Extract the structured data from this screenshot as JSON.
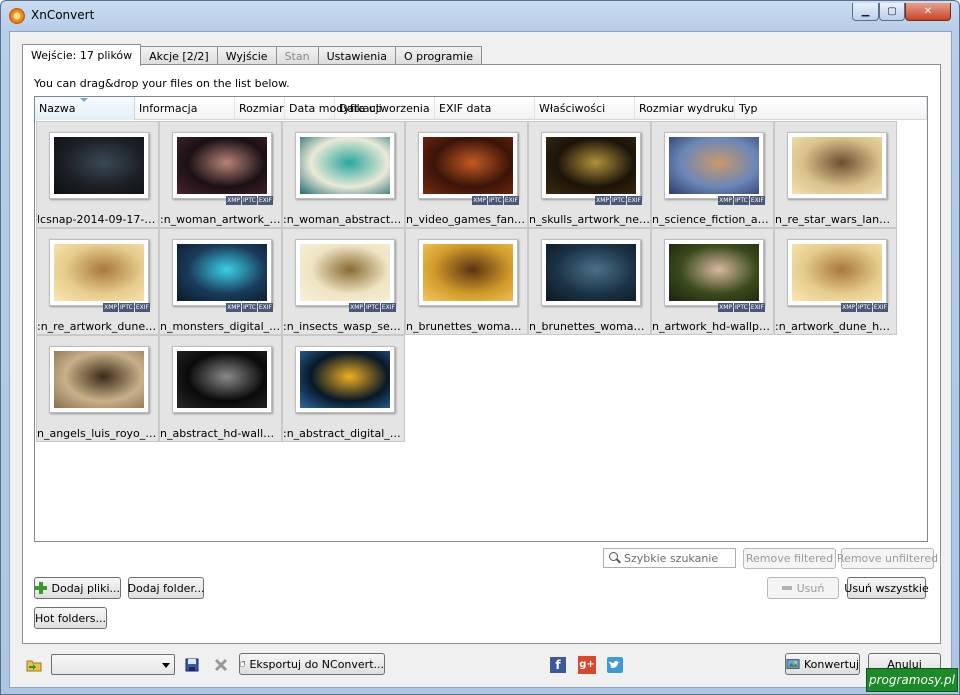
{
  "window": {
    "title": "XnConvert",
    "min_glyph": "▁",
    "max_glyph": "▢",
    "close_glyph": "✕"
  },
  "tabs": [
    {
      "label": "Wejście: 17 plików",
      "state": "active"
    },
    {
      "label": "Akcje [2/2]",
      "state": "normal"
    },
    {
      "label": "Wyjście",
      "state": "normal"
    },
    {
      "label": "Stan",
      "state": "disabled"
    },
    {
      "label": "Ustawienia",
      "state": "normal"
    },
    {
      "label": "O programie",
      "state": "normal"
    }
  ],
  "input": {
    "hint": "You can drag&drop your files on the list below.",
    "columns": [
      "Nazwa",
      "Informacja",
      "Rozmiar",
      "Data modyfikacji",
      "Data utworzenia",
      "EXIF data",
      "Właściwości",
      "Rozmiar wydruku",
      "Typ"
    ],
    "meta_badges": [
      "XMP",
      "IPTC",
      "EXIF"
    ],
    "files": [
      {
        "name": "lcsnap-2014-09-17-13...",
        "badges": false,
        "palette": [
          "#1c2026",
          "#3a4a55",
          "#0d0f12"
        ]
      },
      {
        "name": ":n_woman_artwork_hd...",
        "badges": true,
        "palette": [
          "#1a1014",
          "#b88478",
          "#4a2430"
        ]
      },
      {
        "name": ":n_woman_abstract_d...",
        "badges": false,
        "palette": [
          "#e9ead6",
          "#2aa6a0",
          "#1f6b74"
        ]
      },
      {
        "name": "n_video_games_fanta...",
        "badges": true,
        "palette": [
          "#3a1408",
          "#c45a22",
          "#7a2a12"
        ]
      },
      {
        "name": "n_skulls_artwork_necr...",
        "badges": true,
        "palette": [
          "#1b1408",
          "#b3903c",
          "#3d2a10"
        ]
      },
      {
        "name": "n_science_fiction_art...",
        "badges": true,
        "palette": [
          "#6b86b8",
          "#c89a6a",
          "#2c3d6b"
        ]
      },
      {
        "name": "n_re_star_wars_lands...",
        "badges": false,
        "palette": [
          "#d8c08a",
          "#6a5030",
          "#f2e2b0"
        ]
      },
      {
        "name": ":n_re_artwork_dune_h...",
        "badges": true,
        "palette": [
          "#e6cc8c",
          "#a8783c",
          "#fbe7b4"
        ]
      },
      {
        "name": "n_monsters_digital_ar...",
        "badges": true,
        "palette": [
          "#1a3a5a",
          "#3ad0e8",
          "#0a1a2a"
        ]
      },
      {
        "name": ":n_insects_wasp_sepia...",
        "badges": true,
        "palette": [
          "#efe4c4",
          "#8a6a30",
          "#f8f0d8"
        ]
      },
      {
        "name": "n_brunettes_woman_...",
        "badges": false,
        "palette": [
          "#d29a2a",
          "#5a3410",
          "#f4c860"
        ]
      },
      {
        "name": "n_brunettes_woman_...",
        "badges": false,
        "palette": [
          "#1c3346",
          "#4a7088",
          "#0a1824"
        ]
      },
      {
        "name": "n_artwork_hd-wallpap...",
        "badges": true,
        "palette": [
          "#3a4a1c",
          "#d8b8a0",
          "#1a2410"
        ]
      },
      {
        "name": ":n_artwork_dune_hd-...",
        "badges": true,
        "palette": [
          "#e6cc8c",
          "#a8783c",
          "#fbe7b4"
        ]
      },
      {
        "name": "n_angels_luis_royo_di...",
        "badges": false,
        "palette": [
          "#c8b088",
          "#3a2a18",
          "#8a7050"
        ]
      },
      {
        "name": "n_abstract_hd-wallpa...",
        "badges": false,
        "palette": [
          "#0a0a0a",
          "#8a8a8a",
          "#2a2a2a"
        ]
      },
      {
        "name": ":n_abstract_digital_art...",
        "badges": false,
        "palette": [
          "#081828",
          "#f0b020",
          "#2a6aa0"
        ]
      }
    ]
  },
  "search": {
    "placeholder": "Szybkie szukanie"
  },
  "buttons": {
    "remove_filtered": "Remove filtered",
    "remove_unfiltered": "Remove unfiltered",
    "add_files": "Dodaj pliki...",
    "add_folder": "Dodaj folder...",
    "remove": "Usuń",
    "remove_all": "Usuń wszystkie",
    "hot_folders": "Hot folders...",
    "export_nconvert": "Eksportuj do NConvert...",
    "convert": "Konwertuj",
    "cancel": "Anuluj"
  },
  "preset": {
    "value": ""
  },
  "social": [
    "facebook",
    "google-plus",
    "twitter"
  ],
  "watermark": "programosy.pl",
  "colors": {
    "selection": "#e4e4e4",
    "tab_border": "#8e8f8f",
    "accent_facebook": "#3b5998",
    "accent_gplus": "#d6492f",
    "accent_twitter": "#3d9ad6"
  }
}
